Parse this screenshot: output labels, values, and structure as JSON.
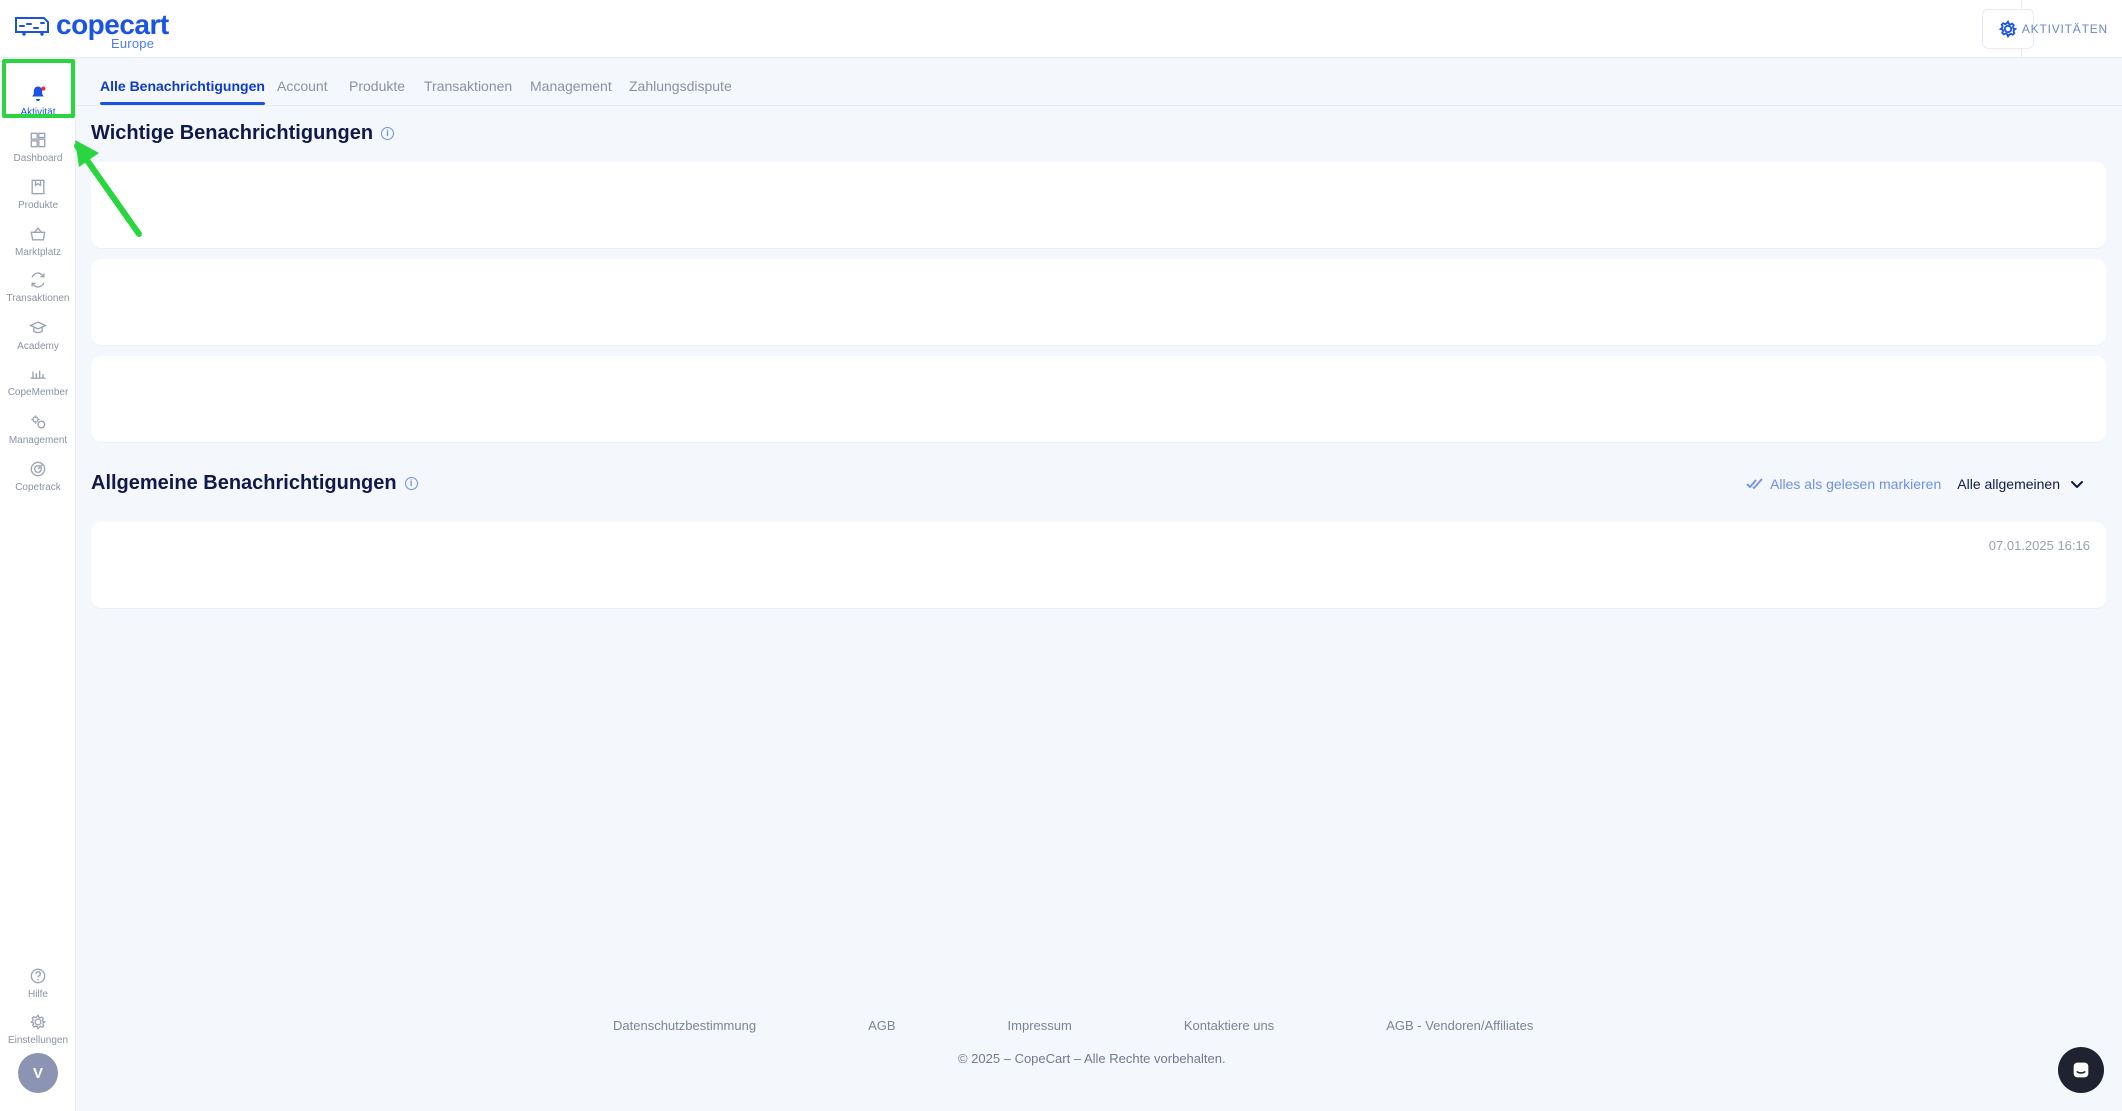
{
  "brand": {
    "name": "copecart",
    "region": "Europe",
    "accent": "#1b54e5"
  },
  "topbar": {
    "activities_label": "AKTIVITÄTEN",
    "settings_icon": "gear-icon"
  },
  "sidebar": {
    "items": [
      {
        "label": "Aktivität",
        "icon": "bell-icon",
        "active": true
      },
      {
        "label": "Dashboard",
        "icon": "dashboard-icon",
        "active": false
      },
      {
        "label": "Produkte",
        "icon": "product-icon",
        "active": false
      },
      {
        "label": "Marktplatz",
        "icon": "basket-icon",
        "active": false
      },
      {
        "label": "Transaktionen",
        "icon": "refresh-icon",
        "active": false
      },
      {
        "label": "Academy",
        "icon": "graduation-cap-icon",
        "active": false
      },
      {
        "label": "CopeMember",
        "icon": "members-icon",
        "active": false
      },
      {
        "label": "Management",
        "icon": "gear-cluster-icon",
        "active": false
      },
      {
        "label": "Copetrack",
        "icon": "radar-icon",
        "active": false
      }
    ],
    "bottom": [
      {
        "label": "Hilfe",
        "icon": "help-icon"
      },
      {
        "label": "Einstellungen",
        "icon": "settings-icon"
      }
    ],
    "avatar_initial": "V"
  },
  "tabs": [
    {
      "label": "Alle Benachrichtigungen",
      "active": true
    },
    {
      "label": "Account",
      "active": false
    },
    {
      "label": "Produkte",
      "active": false
    },
    {
      "label": "Transaktionen",
      "active": false
    },
    {
      "label": "Management",
      "active": false
    },
    {
      "label": "Zahlungsdispute",
      "active": false
    }
  ],
  "important": {
    "title": "Wichtige Benachrichtigungen",
    "card_count": 3
  },
  "general": {
    "title": "Allgemeine Benachrichtigungen",
    "mark_all_read": "Alles als gelesen markieren",
    "filter_label": "Alle allgemeinen",
    "cards": [
      {
        "timestamp": "07.01.2025 16:16"
      }
    ]
  },
  "footer": {
    "links": [
      "Datenschutzbestimmung",
      "AGB",
      "Impressum",
      "Kontaktiere uns",
      "AGB - Vendoren/Affiliates"
    ],
    "copyright": "© 2025 – CopeCart – Alle Rechte vorbehalten."
  },
  "highlight": {
    "color": "#2ad640"
  }
}
